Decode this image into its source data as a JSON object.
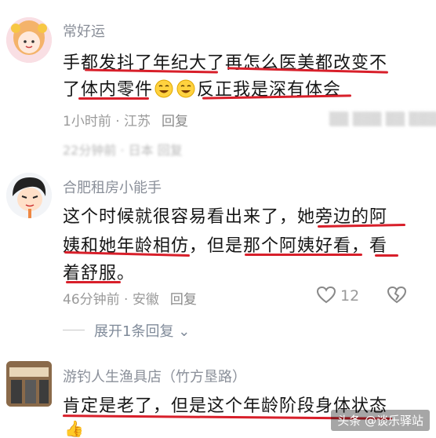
{
  "comments": [
    {
      "username": "常好运",
      "lines": [
        "手都发抖了年纪大了再怎么医美都改变不",
        "了体内零件",
        "反正我是深有体会"
      ],
      "time": "1小时前",
      "location": "江苏",
      "reply": "回复"
    },
    {
      "blurred_meta": "22分钟前 · 日本   回复",
      "username": "合肥租房小能手",
      "lines": [
        "这个时候就很容易看出来了，她旁边的阿",
        "姨和她年龄相仿，但是那个阿姨好看，看",
        "着舒服。"
      ],
      "time": "46分钟前",
      "location": "安徽",
      "reply": "回复",
      "likes": "12"
    },
    {
      "username": "游钓人生渔具店（竹方垦路）",
      "lines": [
        "肯定是老了，但是这个年龄阶段身体状态"
      ]
    }
  ],
  "expand_replies": "展开1条回复",
  "watermark": "头条 @谈乐驿站",
  "colors": {
    "underline": "#d81f2a",
    "meta": "#9a9a9a"
  }
}
